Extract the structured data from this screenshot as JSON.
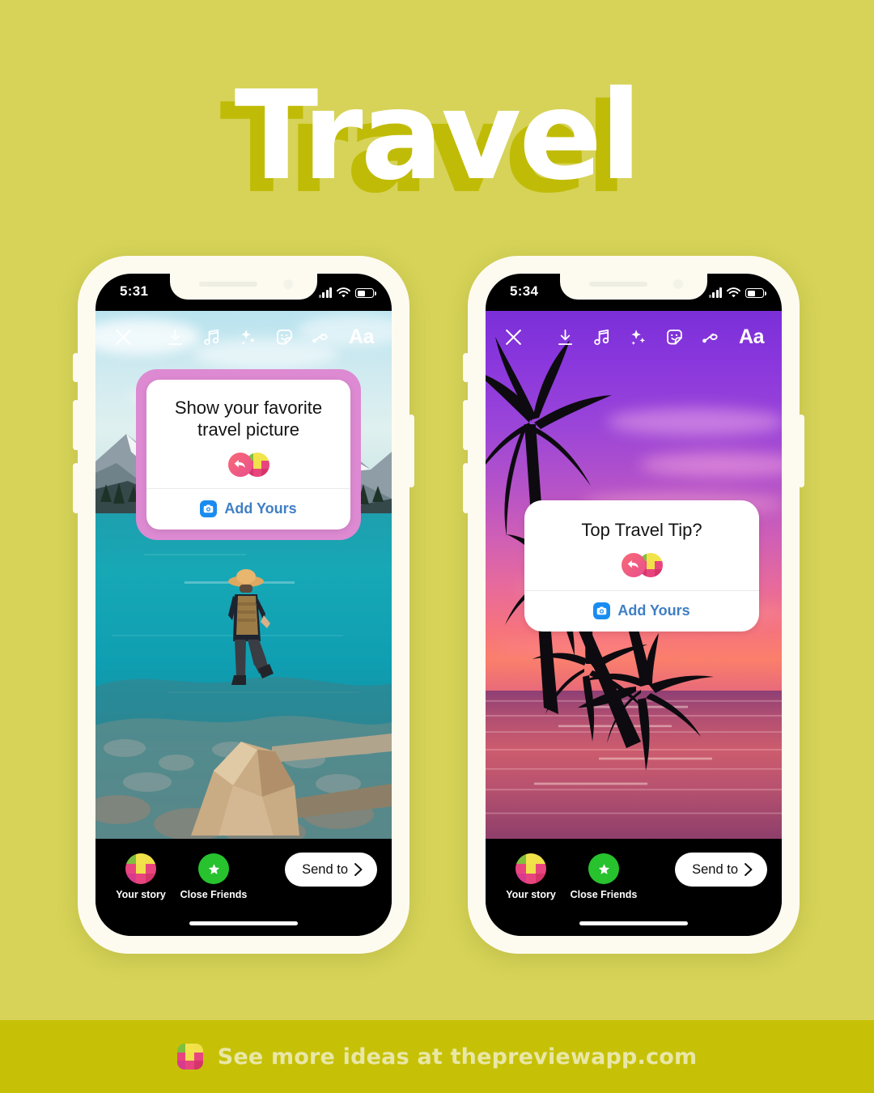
{
  "page": {
    "background_color": "#d6d358",
    "title": "Travel",
    "title_color": "#ffffff",
    "title_shadow_color": "#c0bb07"
  },
  "footer": {
    "text": "See more ideas at thepreviewapp.com",
    "background_color": "#c6c106",
    "text_color": "#e9e7a6",
    "logo_icon": "preview-grid-logo-icon"
  },
  "phones": [
    {
      "id": "phone-1",
      "status": {
        "time": "5:31",
        "signal_icon": "cellular-signal-icon",
        "wifi_icon": "wifi-icon",
        "battery_icon": "battery-icon"
      },
      "toolbar": {
        "close_icon": "close-icon",
        "items": [
          {
            "icon": "download-icon",
            "name": "download-button"
          },
          {
            "icon": "music-note-icon",
            "name": "music-button"
          },
          {
            "icon": "sparkles-icon",
            "name": "effects-button"
          },
          {
            "icon": "sticker-smiley-icon",
            "name": "sticker-button"
          },
          {
            "icon": "squiggle-draw-icon",
            "name": "draw-button"
          }
        ],
        "text_tool_label": "Aa"
      },
      "sticker": {
        "prompt": "Show your favorite travel picture",
        "add_yours_label": "Add Yours",
        "camera_icon": "camera-icon",
        "reply_avatar_icon": "reply-arrow-avatar-icon",
        "grid_avatar_icon": "preview-grid-avatar-icon",
        "frame_color": "#dd8ad2",
        "link_color": "#3f7fc4"
      },
      "bottom_bar": {
        "your_story_label": "Your story",
        "your_story_icon": "preview-grid-avatar-icon",
        "close_friends_label": "Close Friends",
        "close_friends_icon": "green-star-icon",
        "send_to_label": "Send to",
        "send_to_icon": "chevron-right-icon"
      },
      "photo": {
        "name": "moraine-lake-photo",
        "description": "Person in hat standing on rock above turquoise mountain lake"
      }
    },
    {
      "id": "phone-2",
      "status": {
        "time": "5:34",
        "signal_icon": "cellular-signal-icon",
        "wifi_icon": "wifi-icon",
        "battery_icon": "battery-icon"
      },
      "toolbar": {
        "close_icon": "close-icon",
        "items": [
          {
            "icon": "download-icon",
            "name": "download-button"
          },
          {
            "icon": "music-note-icon",
            "name": "music-button"
          },
          {
            "icon": "sparkles-icon",
            "name": "effects-button"
          },
          {
            "icon": "sticker-smiley-icon",
            "name": "sticker-button"
          },
          {
            "icon": "squiggle-draw-icon",
            "name": "draw-button"
          }
        ],
        "text_tool_label": "Aa"
      },
      "sticker": {
        "prompt": "Top Travel Tip?",
        "add_yours_label": "Add Yours",
        "camera_icon": "camera-icon",
        "reply_avatar_icon": "reply-arrow-avatar-icon",
        "grid_avatar_icon": "preview-grid-avatar-icon",
        "frame_color": "none",
        "link_color": "#3f7fc4"
      },
      "bottom_bar": {
        "your_story_label": "Your story",
        "your_story_icon": "preview-grid-avatar-icon",
        "close_friends_label": "Close Friends",
        "close_friends_icon": "green-star-icon",
        "send_to_label": "Send to",
        "send_to_icon": "chevron-right-icon"
      },
      "photo": {
        "name": "tropical-sunset-photo",
        "description": "Palm tree silhouettes over pink purple sunset ocean"
      }
    }
  ],
  "palette": {
    "grid_colors": [
      "#6ec45a",
      "#f0e04a",
      "#e8d34a",
      "#e8457f",
      "#d93a8e",
      "#e8457f",
      "#e03a6e",
      "#d6356a",
      "#e8457f"
    ]
  }
}
